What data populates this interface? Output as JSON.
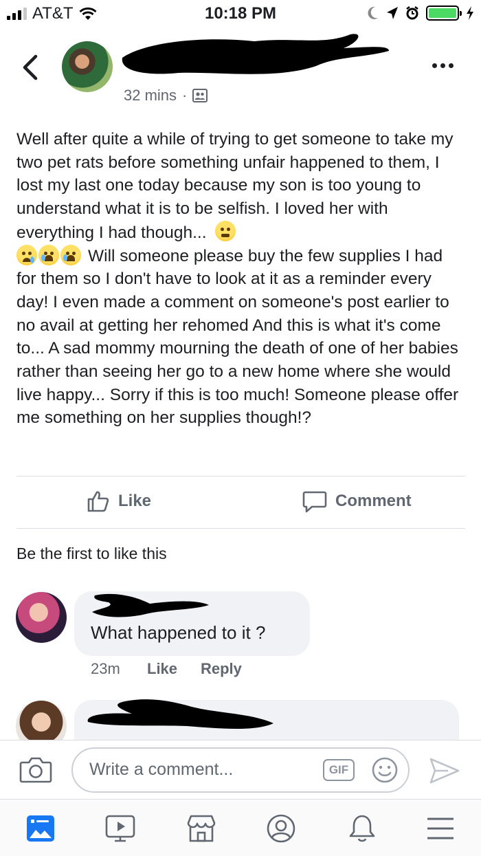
{
  "status_bar": {
    "carrier": "AT&T",
    "time": "10:18 PM"
  },
  "post": {
    "time_ago": "32 mins",
    "separator": "·",
    "body": [
      "Well after quite a while of trying to get someone to take my two pet rats before something unfair happened to them, I lost my last one today because my son is too young to understand what it is to be selfish. I loved her with everything I had though...",
      "Will someone please buy the few supplies I had for them so I don't have to look at it as a reminder every day! I even made a comment on someone's post earlier to no avail at getting her rehomed And this is what it's come to... A sad mommy mourning the death of one of her babies rather than seeing her go to a new home where she would live happy... Sorry if this is too much! Someone please offer me something on her supplies though!?"
    ],
    "emoji_names": [
      "tired-face",
      "sad-face",
      "crying-face",
      "crying-face"
    ]
  },
  "actions": {
    "like": "Like",
    "comment": "Comment"
  },
  "reactions_summary": "Be the first to like this",
  "comments": [
    {
      "text": "What happened to it ?",
      "time": "23m",
      "like": "Like",
      "reply": "Reply"
    }
  ],
  "composer": {
    "placeholder": "Write a comment...",
    "gif": "GIF"
  },
  "nav": [
    "news-feed-icon",
    "watch-icon",
    "marketplace-icon",
    "profile-icon",
    "notifications-icon",
    "menu-icon"
  ],
  "colors": {
    "text": "#1c1e21",
    "secondary": "#606770",
    "bubble": "#f0f2f5",
    "battery": "#4cd964",
    "nav_active": "#1877f2"
  }
}
